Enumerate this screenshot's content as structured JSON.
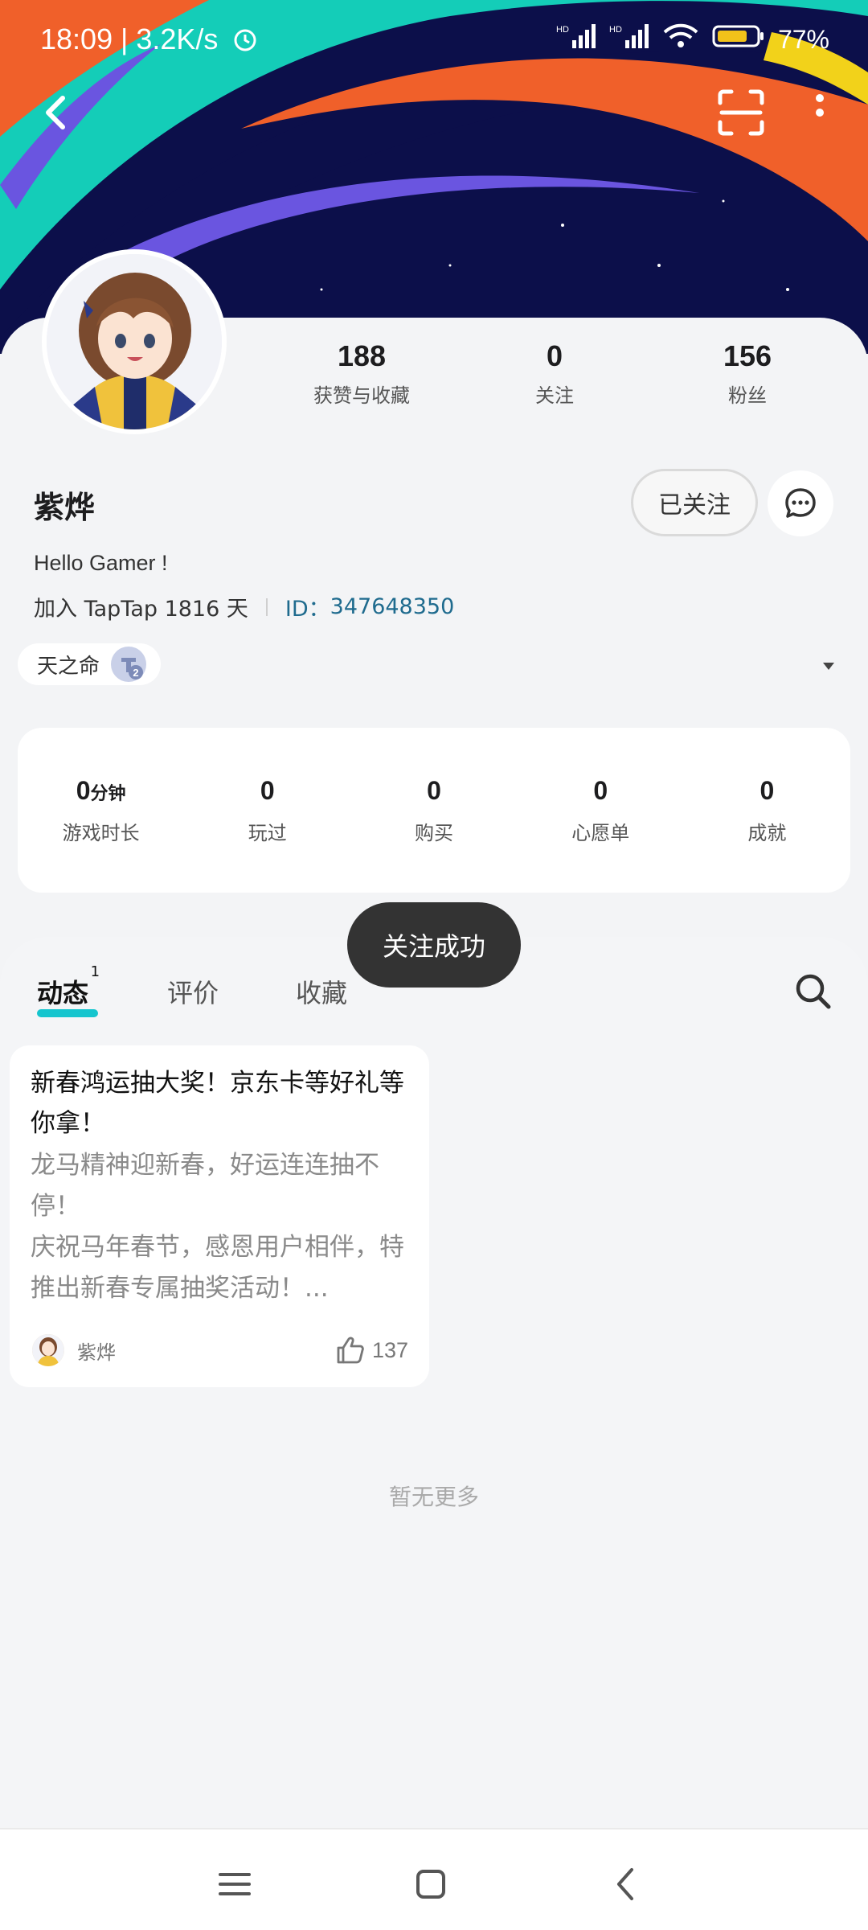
{
  "status_bar": {
    "time": "18:09",
    "speed": "| 3.2K/s",
    "battery": "77%",
    "signal_label": "HD"
  },
  "profile": {
    "likes_collects": "188",
    "likes_collects_label": "获赞与收藏",
    "following": "0",
    "following_label": "关注",
    "fans": "156",
    "fans_label": "粉丝",
    "username": "紫烨",
    "followed_label": "已关注",
    "bio": "Hello Gamer !",
    "joined_text": "加入 TapTap 1816 天",
    "id_label": "ID：",
    "id_value": "347648350",
    "title_chip": "天之命",
    "title_badge_number": "2"
  },
  "game_stats": {
    "playtime_value": "0",
    "playtime_unit": "分钟",
    "playtime_label": "游戏时长",
    "played_value": "0",
    "played_label": "玩过",
    "bought_value": "0",
    "bought_label": "购买",
    "wishlist_value": "0",
    "wishlist_label": "心愿单",
    "achievements_value": "0",
    "achievements_label": "成就"
  },
  "tabs": {
    "feed": "动态",
    "feed_count": "1",
    "reviews": "评价",
    "favorites": "收藏"
  },
  "post": {
    "title": "新春鸿运抽大奖！京东卡等好礼等你拿！",
    "body": "龙马精神迎新春，好运连连抽不停！\n庆祝马年春节，感恩用户相伴，特推出新春专属抽奖活动！...",
    "author": "紫烨",
    "likes": "137"
  },
  "footer_text": "暂无更多",
  "toast": "关注成功",
  "colors": {
    "accent": "#15c5ce",
    "id_link": "#1f6b8e",
    "banner_bg": "#0c0f4a",
    "banner_teal": "#14cdb8",
    "banner_orange": "#f0602a",
    "banner_purple": "#6a55e0",
    "banner_yellow": "#f2d21a"
  }
}
